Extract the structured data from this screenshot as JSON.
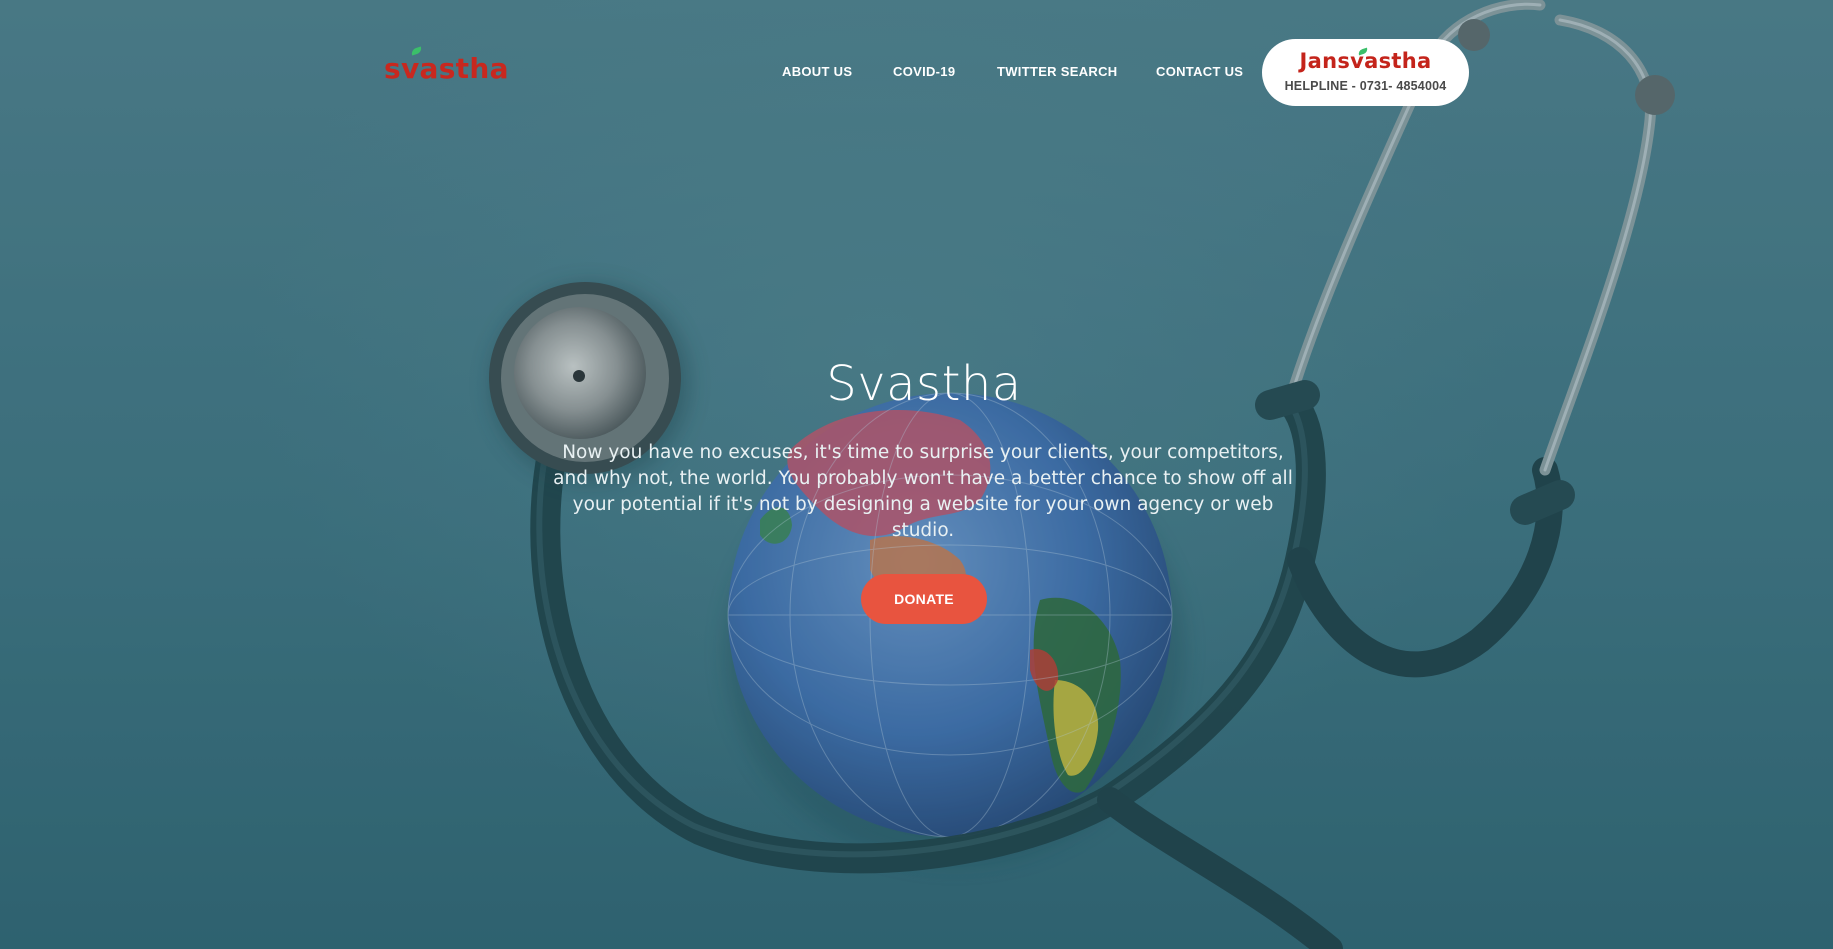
{
  "brand": {
    "logo_text": "svastha",
    "logo_color": "#c8281f",
    "leaf_color": "#3bbf6a"
  },
  "nav": {
    "items": [
      {
        "label": "ABOUT US"
      },
      {
        "label": "COVID-19"
      },
      {
        "label": "TWITTER SEARCH"
      },
      {
        "label": "CONTACT US"
      }
    ],
    "helpline": {
      "brand": "Jansvastha",
      "phone": "HELPLINE - 0731- 4854004"
    }
  },
  "hero": {
    "title": "Svastha",
    "text": "Now you have no excuses, it's time to surprise your clients, your competitors, and why not, the world. You probably won't have a better chance to show off all your potential if it's not by designing a website for your own agency or web studio.",
    "cta_label": "DONATE",
    "cta_color": "#e8543f",
    "background_image": "stethoscope-wrapped-around-globe"
  }
}
